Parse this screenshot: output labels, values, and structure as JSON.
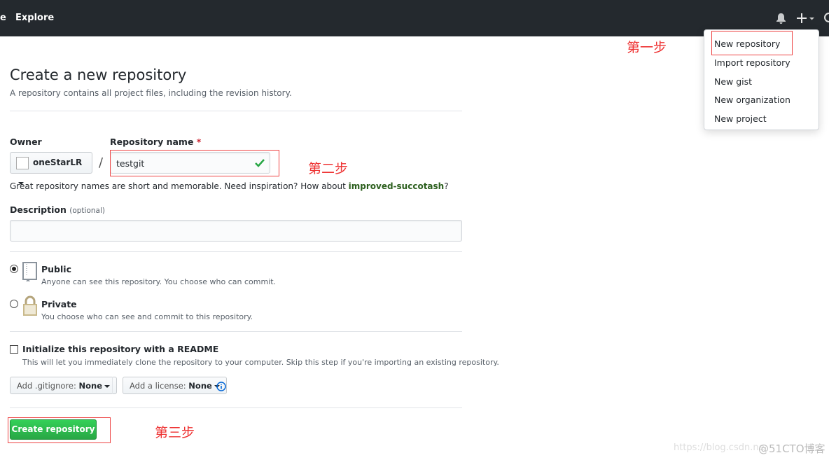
{
  "topbar": {
    "partial_nav": "e",
    "explore": "Explore"
  },
  "new_menu": {
    "items": [
      "New repository",
      "Import repository",
      "New gist",
      "New organization",
      "New project"
    ]
  },
  "annotations": {
    "step1": "第一步",
    "step2": "第二步",
    "step3": "第三步"
  },
  "page": {
    "title": "Create a new repository",
    "subtitle": "A repository contains all project files, including the revision history."
  },
  "form": {
    "owner_label": "Owner",
    "owner_value": "oneStarLR",
    "separator": "/",
    "repo_label": "Repository name",
    "required_mark": "*",
    "repo_value": "testgit",
    "hint_prefix": "Great repository names are short and memorable. Need inspiration? How about ",
    "hint_suggestion": "improved-succotash",
    "hint_suffix": "?",
    "description_label": "Description",
    "description_optional": "(optional)",
    "description_value": "",
    "public_label": "Public",
    "public_desc": "Anyone can see this repository. You choose who can commit.",
    "private_label": "Private",
    "private_desc": "You choose who can see and commit to this repository.",
    "visibility_selected": "Public",
    "readme_label": "Initialize this repository with a README",
    "readme_checked": false,
    "readme_desc": "This will let you immediately clone the repository to your computer. Skip this step if you're importing an existing repository.",
    "gitignore_prefix": "Add .gitignore:",
    "gitignore_value": "None",
    "license_prefix": "Add a license:",
    "license_value": "None",
    "create_button": "Create repository"
  },
  "watermark": {
    "csdn": "https://blog.csdn.ne",
    "cto": "@51CTO博客"
  },
  "colors": {
    "topbar": "#24292e",
    "green": "#2cbe4e",
    "annotation_red": "#ee3333",
    "link_green": "#2c5f1e"
  }
}
